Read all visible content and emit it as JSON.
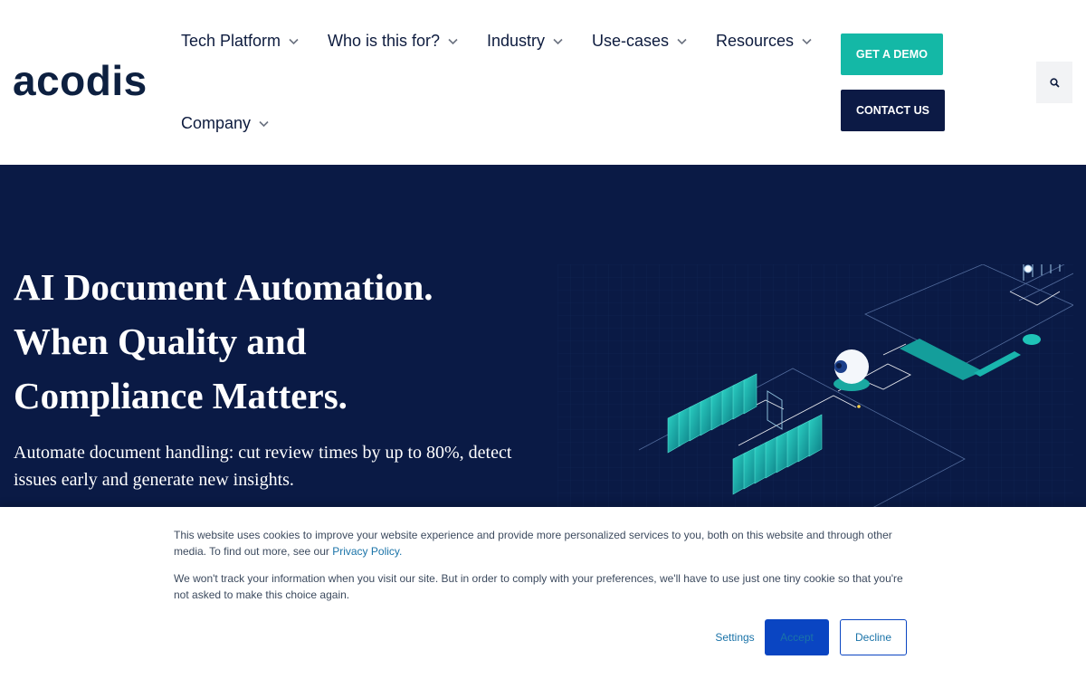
{
  "brand": {
    "logo_text": "acodis",
    "colors": {
      "navy": "#0a1a45",
      "teal": "#14b8a6",
      "accept_blue": "#0a45c2"
    }
  },
  "nav": {
    "items": [
      {
        "label": "Tech Platform",
        "icon": "chevron-down-icon"
      },
      {
        "label": "Who is this for?",
        "icon": "chevron-down-icon"
      },
      {
        "label": "Industry",
        "icon": "chevron-down-icon"
      },
      {
        "label": "Use-cases",
        "icon": "chevron-down-icon"
      },
      {
        "label": "Resources",
        "icon": "chevron-down-icon"
      },
      {
        "label": "Company",
        "icon": "chevron-down-icon"
      }
    ],
    "demo_label": "GET A DEMO",
    "contact_label": "CONTACT US",
    "search_icon": "search-icon"
  },
  "hero": {
    "title_lines": [
      "AI Document Automation.",
      "When Quality and",
      "Compliance Matters."
    ],
    "subtitle": "Automate document handling: cut review times by up to 80%, detect issues early and generate new insights."
  },
  "cookie": {
    "text1": "This website uses cookies to improve your website experience and provide more personalized services to you, both on this website and through other media. To find out more, see our",
    "privacy_link": "Privacy Policy.",
    "text2": "We won't track your information when you visit our site. But in order to comply with your preferences, we'll have to use just one tiny cookie so that you're not asked to make this choice again.",
    "settings_label": "Settings",
    "accept_label": "Accept",
    "decline_label": "Decline"
  }
}
